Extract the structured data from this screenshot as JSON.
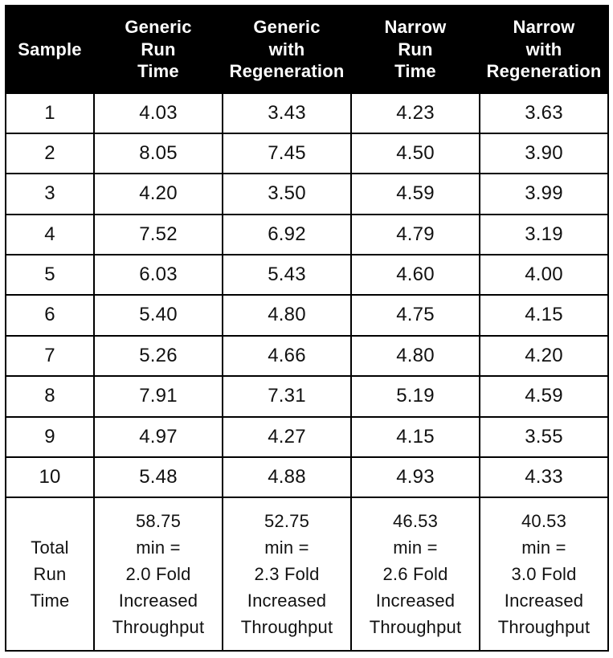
{
  "headers": {
    "sample": "Sample",
    "c1": "Generic<br>Run<br>Time",
    "c2": "Generic<br>with<br>Regeneration",
    "c3": "Narrow<br>Run<br>Time",
    "c4": "Narrow<br>with<br>Regeneration"
  },
  "rows": [
    {
      "sample": "1",
      "c1": "4.03",
      "c2": "3.43",
      "c3": "4.23",
      "c4": "3.63"
    },
    {
      "sample": "2",
      "c1": "8.05",
      "c2": "7.45",
      "c3": "4.50",
      "c4": "3.90"
    },
    {
      "sample": "3",
      "c1": "4.20",
      "c2": "3.50",
      "c3": "4.59",
      "c4": "3.99"
    },
    {
      "sample": "4",
      "c1": "7.52",
      "c2": "6.92",
      "c3": "4.79",
      "c4": "3.19"
    },
    {
      "sample": "5",
      "c1": "6.03",
      "c2": "5.43",
      "c3": "4.60",
      "c4": "4.00"
    },
    {
      "sample": "6",
      "c1": "5.40",
      "c2": "4.80",
      "c3": "4.75",
      "c4": "4.15"
    },
    {
      "sample": "7",
      "c1": "5.26",
      "c2": "4.66",
      "c3": "4.80",
      "c4": "4.20"
    },
    {
      "sample": "8",
      "c1": "7.91",
      "c2": "7.31",
      "c3": "5.19",
      "c4": "4.59"
    },
    {
      "sample": "9",
      "c1": "4.97",
      "c2": "4.27",
      "c3": "4.15",
      "c4": "3.55"
    },
    {
      "sample": "10",
      "c1": "5.48",
      "c2": "4.88",
      "c3": "4.93",
      "c4": "4.33"
    }
  ],
  "footer": {
    "label": "Total<br>Run<br>Time",
    "c1": "58.75<br>min =<br>2.0 Fold<br>Increased<br>Throughput",
    "c2": "52.75<br>min =<br>2.3 Fold<br>Increased<br>Throughput",
    "c3": "46.53<br>min =<br>2.6 Fold<br>Increased<br>Throughput",
    "c4": "40.53<br>min =<br>3.0 Fold<br>Increased<br>Throughput"
  },
  "chart_data": {
    "type": "table",
    "columns": [
      "Sample",
      "Generic Run Time",
      "Generic with Regeneration",
      "Narrow Run Time",
      "Narrow with Regeneration"
    ],
    "rows": [
      [
        1,
        4.03,
        3.43,
        4.23,
        3.63
      ],
      [
        2,
        8.05,
        7.45,
        4.5,
        3.9
      ],
      [
        3,
        4.2,
        3.5,
        4.59,
        3.99
      ],
      [
        4,
        7.52,
        6.92,
        4.79,
        3.19
      ],
      [
        5,
        6.03,
        5.43,
        4.6,
        4.0
      ],
      [
        6,
        5.4,
        4.8,
        4.75,
        4.15
      ],
      [
        7,
        5.26,
        4.66,
        4.8,
        4.2
      ],
      [
        8,
        7.91,
        7.31,
        5.19,
        4.59
      ],
      [
        9,
        4.97,
        4.27,
        4.15,
        3.55
      ],
      [
        10,
        5.48,
        4.88,
        4.93,
        4.33
      ]
    ],
    "totals": {
      "Generic Run Time": {
        "minutes": 58.75,
        "fold_increase": 2.0
      },
      "Generic with Regeneration": {
        "minutes": 52.75,
        "fold_increase": 2.3
      },
      "Narrow Run Time": {
        "minutes": 46.53,
        "fold_increase": 2.6
      },
      "Narrow with Regeneration": {
        "minutes": 40.53,
        "fold_increase": 3.0
      }
    }
  }
}
